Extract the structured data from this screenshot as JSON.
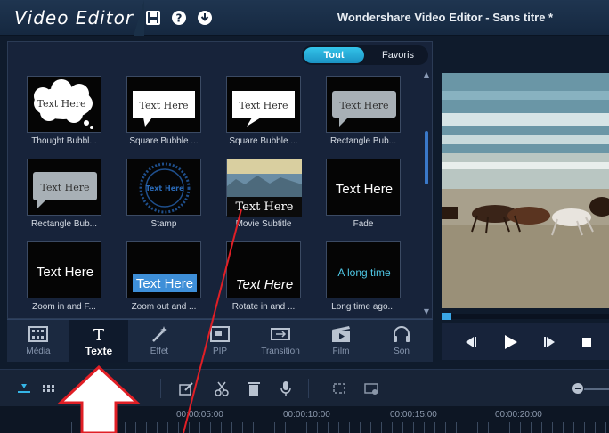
{
  "titlebar": {
    "brand": "Video Editor",
    "window_title": "Wondershare Video Editor - Sans titre *"
  },
  "library": {
    "filter": {
      "all_label": "Tout",
      "fav_label": "Favoris",
      "selected": "Tout"
    },
    "items": [
      {
        "label": "Thought Bubbl...",
        "sample": "Text Here"
      },
      {
        "label": "Square Bubble ...",
        "sample": "Text Here"
      },
      {
        "label": "Square Bubble ...",
        "sample": "Text Here"
      },
      {
        "label": "Rectangle Bub...",
        "sample": "Text Here"
      },
      {
        "label": "Rectangle Bub...",
        "sample": "Text Here"
      },
      {
        "label": "Stamp",
        "sample": "Text Here"
      },
      {
        "label": "Movie Subtitle",
        "sample": "Text Here"
      },
      {
        "label": "Fade",
        "sample": "Text Here"
      },
      {
        "label": "Zoom in and F...",
        "sample": "Text Here"
      },
      {
        "label": "Zoom out and ...",
        "sample": "Text Here"
      },
      {
        "label": "Rotate in and ...",
        "sample": "Text Here"
      },
      {
        "label": "Long time ago...",
        "sample": "A long time"
      }
    ]
  },
  "categories": [
    {
      "label": "Média",
      "icon": "film-strip-icon"
    },
    {
      "label": "Texte",
      "icon": "text-t-icon",
      "active": true
    },
    {
      "label": "Effet",
      "icon": "magic-wand-icon"
    },
    {
      "label": "PIP",
      "icon": "pip-icon"
    },
    {
      "label": "Transition",
      "icon": "transition-icon"
    },
    {
      "label": "Film",
      "icon": "movie-icon"
    },
    {
      "label": "Son",
      "icon": "headphones-icon"
    }
  ],
  "timeline": {
    "ticks": [
      "00:00:05:00",
      "00:00:10:00",
      "00:00:15:00",
      "00:00:20:00"
    ]
  },
  "colors": {
    "accent": "#2aa8dd",
    "annotation": "#e01f26"
  }
}
